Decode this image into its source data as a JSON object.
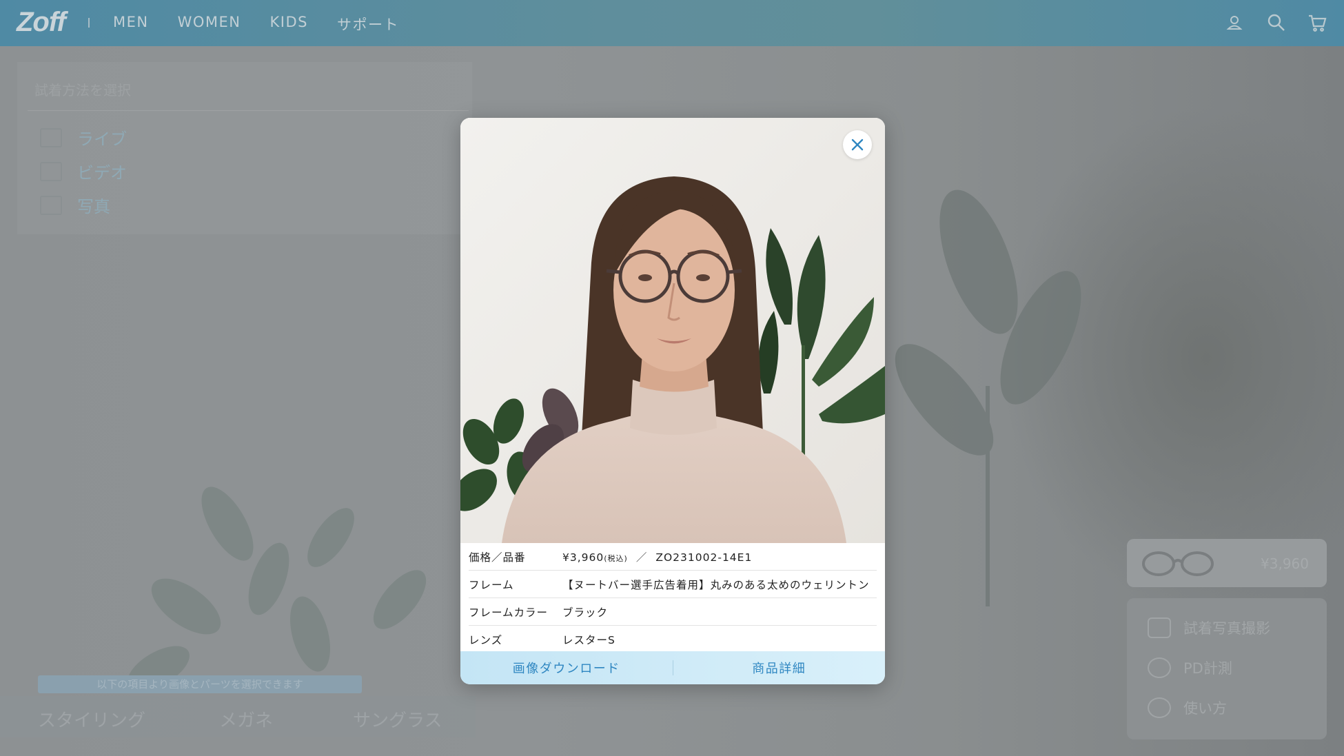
{
  "header": {
    "logo": "Zoff",
    "nav": [
      "MEN",
      "WOMEN",
      "KIDS",
      "サポート"
    ],
    "icons": [
      "user-icon",
      "search-icon",
      "cart-icon"
    ]
  },
  "background": {
    "left_panel": {
      "title": "試着方法を選択",
      "options": [
        {
          "label": "ライブ",
          "icon": "checkbox-icon"
        },
        {
          "label": "ビデオ",
          "icon": "video-icon"
        },
        {
          "label": "写真",
          "icon": "camera-icon"
        }
      ]
    },
    "notice": "以下の項目より画像とパーツを選択できます",
    "bottom_tabs": [
      "スタイリング",
      "メガネ",
      "サングラス"
    ],
    "right_card": {
      "price": "¥3,960"
    },
    "right_menu": [
      {
        "label": "試着写真撮影",
        "icon": "camera-icon"
      },
      {
        "label": "PD計測",
        "icon": "eye-icon"
      },
      {
        "label": "使い方",
        "icon": "help-icon"
      }
    ]
  },
  "modal": {
    "rows": [
      {
        "key": "価格／品番",
        "price": "¥3,960",
        "tax": "(税込)",
        "sep": "／",
        "code": "ZO231002-14E1"
      },
      {
        "key": "フレーム",
        "value": "【ヌートバー選手広告着用】丸みのある太めのウェリントン"
      },
      {
        "key": "フレームカラー",
        "value": "ブラック"
      },
      {
        "key": "レンズ",
        "value": "レスターS"
      }
    ],
    "actions": {
      "download": "画像ダウンロード",
      "detail": "商品詳細"
    }
  },
  "colors": {
    "accent": "#2e86c1",
    "header": "#5f8e9c",
    "action_bar": "#cfeaf7"
  }
}
